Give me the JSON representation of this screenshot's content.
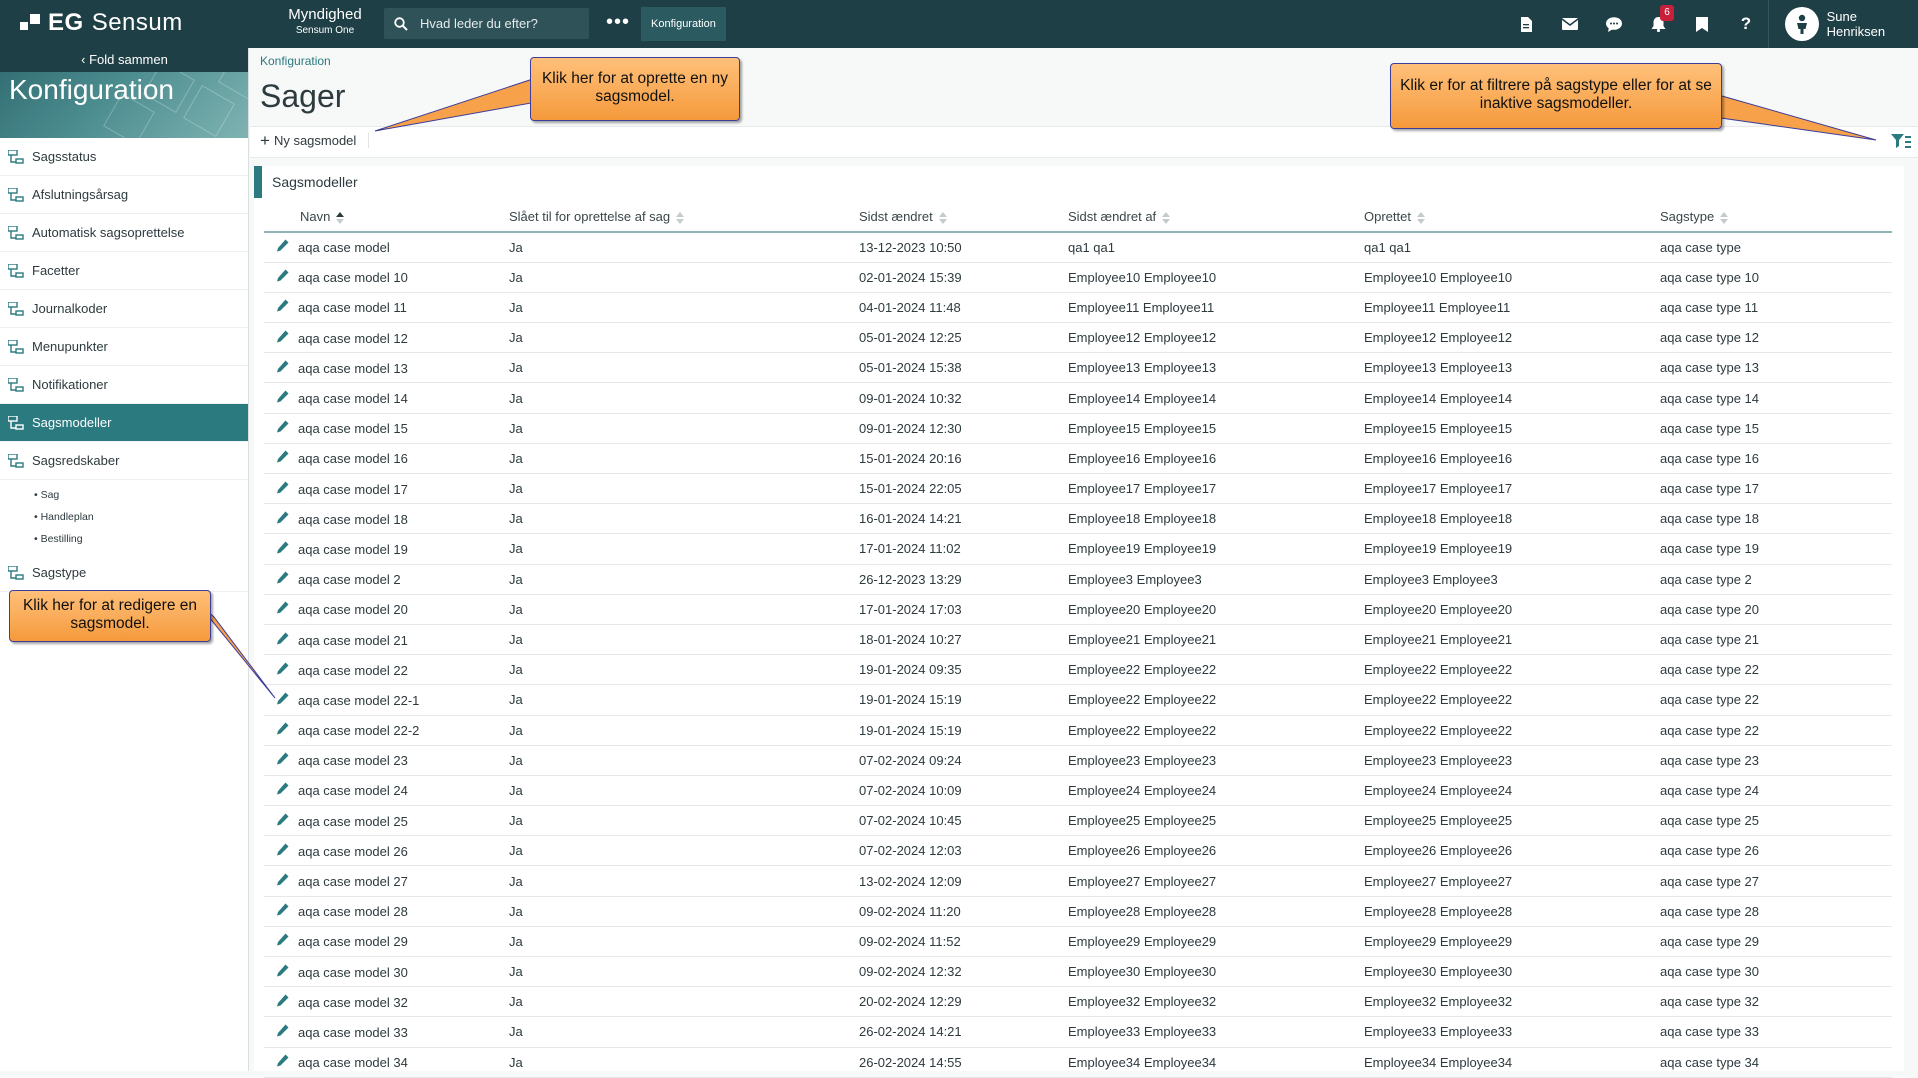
{
  "brand": {
    "logo_bold": "EG",
    "logo_name": "Sensum"
  },
  "org": {
    "name": "Myndighed",
    "sub": "Sensum One"
  },
  "search": {
    "placeholder": "Hvad leder du efter?"
  },
  "topbar": {
    "more": "•••",
    "active_tab": "Konfiguration",
    "notification_count": "6"
  },
  "user": {
    "name": "Sune Henriksen"
  },
  "sidebar": {
    "fold": "Fold sammen",
    "title": "Konfiguration",
    "items": [
      {
        "label": "Sagsstatus",
        "active": false
      },
      {
        "label": "Afslutningsårsag",
        "active": false
      },
      {
        "label": "Automatisk sagsoprettelse",
        "active": false
      },
      {
        "label": "Facetter",
        "active": false
      },
      {
        "label": "Journalkoder",
        "active": false
      },
      {
        "label": "Menupunkter",
        "active": false
      },
      {
        "label": "Notifikationer",
        "active": false
      },
      {
        "label": "Sagsmodeller",
        "active": true
      },
      {
        "label": "Sagsredskaber",
        "active": false
      }
    ],
    "subitems": [
      "Sag",
      "Handleplan",
      "Bestilling"
    ],
    "last_item": "Sagstype"
  },
  "main": {
    "breadcrumb": "Konfiguration",
    "title": "Sager",
    "new_button": "Ny sagsmodel",
    "panel_title": "Sagsmodeller",
    "columns": [
      "Navn",
      "Slået til for oprettelse af sag",
      "Sidst ændret",
      "Sidst ændret af",
      "Oprettet",
      "Sagstype"
    ],
    "rows": [
      [
        "aqa case model",
        "Ja",
        "13-12-2023 10:50",
        "qa1 qa1",
        "qa1 qa1",
        "aqa case type"
      ],
      [
        "aqa case model 10",
        "Ja",
        "02-01-2024 15:39",
        "Employee10 Employee10",
        "Employee10 Employee10",
        "aqa case type 10"
      ],
      [
        "aqa case model 11",
        "Ja",
        "04-01-2024 11:48",
        "Employee11 Employee11",
        "Employee11 Employee11",
        "aqa case type 11"
      ],
      [
        "aqa case model 12",
        "Ja",
        "05-01-2024 12:25",
        "Employee12 Employee12",
        "Employee12 Employee12",
        "aqa case type 12"
      ],
      [
        "aqa case model 13",
        "Ja",
        "05-01-2024 15:38",
        "Employee13 Employee13",
        "Employee13 Employee13",
        "aqa case type 13"
      ],
      [
        "aqa case model 14",
        "Ja",
        "09-01-2024 10:32",
        "Employee14 Employee14",
        "Employee14 Employee14",
        "aqa case type 14"
      ],
      [
        "aqa case model 15",
        "Ja",
        "09-01-2024 12:30",
        "Employee15 Employee15",
        "Employee15 Employee15",
        "aqa case type 15"
      ],
      [
        "aqa case model 16",
        "Ja",
        "15-01-2024 20:16",
        "Employee16 Employee16",
        "Employee16 Employee16",
        "aqa case type 16"
      ],
      [
        "aqa case model 17",
        "Ja",
        "15-01-2024 22:05",
        "Employee17 Employee17",
        "Employee17 Employee17",
        "aqa case type 17"
      ],
      [
        "aqa case model 18",
        "Ja",
        "16-01-2024 14:21",
        "Employee18 Employee18",
        "Employee18 Employee18",
        "aqa case type 18"
      ],
      [
        "aqa case model 19",
        "Ja",
        "17-01-2024 11:02",
        "Employee19 Employee19",
        "Employee19 Employee19",
        "aqa case type 19"
      ],
      [
        "aqa case model 2",
        "Ja",
        "26-12-2023 13:29",
        "Employee3 Employee3",
        "Employee3 Employee3",
        "aqa case type 2"
      ],
      [
        "aqa case model 20",
        "Ja",
        "17-01-2024 17:03",
        "Employee20 Employee20",
        "Employee20 Employee20",
        "aqa case type 20"
      ],
      [
        "aqa case model 21",
        "Ja",
        "18-01-2024 10:27",
        "Employee21 Employee21",
        "Employee21 Employee21",
        "aqa case type 21"
      ],
      [
        "aqa case model 22",
        "Ja",
        "19-01-2024 09:35",
        "Employee22 Employee22",
        "Employee22 Employee22",
        "aqa case type 22"
      ],
      [
        "aqa case model 22-1",
        "Ja",
        "19-01-2024 15:19",
        "Employee22 Employee22",
        "Employee22 Employee22",
        "aqa case type 22"
      ],
      [
        "aqa case model 22-2",
        "Ja",
        "19-01-2024 15:19",
        "Employee22 Employee22",
        "Employee22 Employee22",
        "aqa case type 22"
      ],
      [
        "aqa case model 23",
        "Ja",
        "07-02-2024 09:24",
        "Employee23 Employee23",
        "Employee23 Employee23",
        "aqa case type 23"
      ],
      [
        "aqa case model 24",
        "Ja",
        "07-02-2024 10:09",
        "Employee24 Employee24",
        "Employee24 Employee24",
        "aqa case type 24"
      ],
      [
        "aqa case model 25",
        "Ja",
        "07-02-2024 10:45",
        "Employee25 Employee25",
        "Employee25 Employee25",
        "aqa case type 25"
      ],
      [
        "aqa case model 26",
        "Ja",
        "07-02-2024 12:03",
        "Employee26 Employee26",
        "Employee26 Employee26",
        "aqa case type 26"
      ],
      [
        "aqa case model 27",
        "Ja",
        "13-02-2024 12:09",
        "Employee27 Employee27",
        "Employee27 Employee27",
        "aqa case type 27"
      ],
      [
        "aqa case model 28",
        "Ja",
        "09-02-2024 11:20",
        "Employee28 Employee28",
        "Employee28 Employee28",
        "aqa case type 28"
      ],
      [
        "aqa case model 29",
        "Ja",
        "09-02-2024 11:52",
        "Employee29 Employee29",
        "Employee29 Employee29",
        "aqa case type 29"
      ],
      [
        "aqa case model 30",
        "Ja",
        "09-02-2024 12:32",
        "Employee30 Employee30",
        "Employee30 Employee30",
        "aqa case type 30"
      ],
      [
        "aqa case model 32",
        "Ja",
        "20-02-2024 12:29",
        "Employee32 Employee32",
        "Employee32 Employee32",
        "aqa case type 32"
      ],
      [
        "aqa case model 33",
        "Ja",
        "26-02-2024 14:21",
        "Employee33 Employee33",
        "Employee33 Employee33",
        "aqa case type 33"
      ],
      [
        "aqa case model 34",
        "Ja",
        "26-02-2024 14:55",
        "Employee34 Employee34",
        "Employee34 Employee34",
        "aqa case type 34"
      ]
    ]
  },
  "callouts": {
    "new_model": "Klik her for at oprette en ny sagsmodel.",
    "filter": "Klik er for at filtrere på sagstype eller for at se inaktive sagsmodeller.",
    "edit": "Klik her for at redigere en sagsmodel."
  },
  "colors": {
    "topbar": "#1e3f45",
    "accent": "#2a7a80",
    "callout": "#f59a3c",
    "badge": "#c8203a"
  },
  "icons": {
    "logo": "eg-logo-icon",
    "search": "search-icon",
    "document": "document-icon",
    "mail": "mail-icon",
    "chat": "chat-icon",
    "bell": "bell-icon",
    "bookmark": "bookmark-icon",
    "help": "help-icon",
    "user": "user-icon",
    "edit": "pencil-icon",
    "filter": "filter-icon",
    "nav": "tree-icon"
  }
}
